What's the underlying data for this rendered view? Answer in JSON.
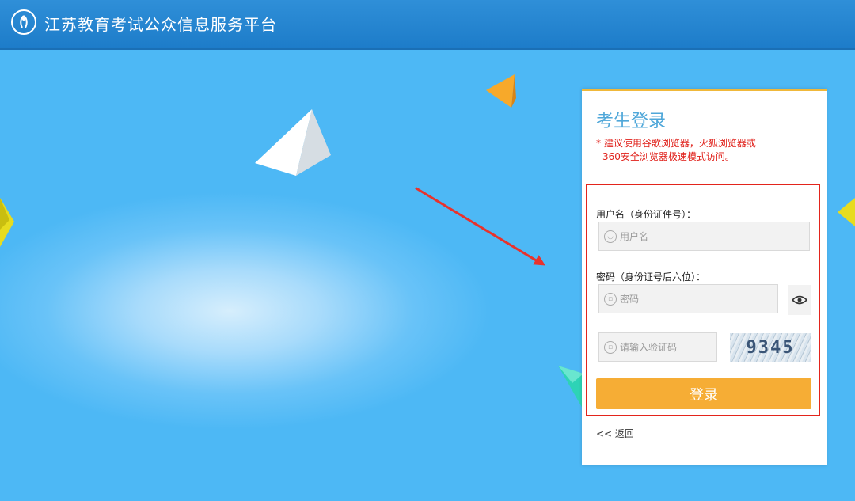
{
  "header": {
    "title": "江苏教育考试公众信息服务平台"
  },
  "login": {
    "title": "考生登录",
    "notice_line1": "* 建议使用谷歌浏览器，火狐浏览器或",
    "notice_line2": "360安全浏览器极速模式访问。",
    "username_label": "用户名（身份证件号）：",
    "username_placeholder": "用户名",
    "password_label": "密码（身份证号后六位）：",
    "password_placeholder": "密码",
    "captcha_placeholder": "请输入验证码",
    "captcha_code": "9345",
    "login_button": "登录",
    "back_link": "<< 返回"
  },
  "colors": {
    "header": "#1d7cc9",
    "background": "#4db8f5",
    "button": "#f6ad35",
    "highlight": "#e3241c",
    "title": "#4fa7d9"
  }
}
